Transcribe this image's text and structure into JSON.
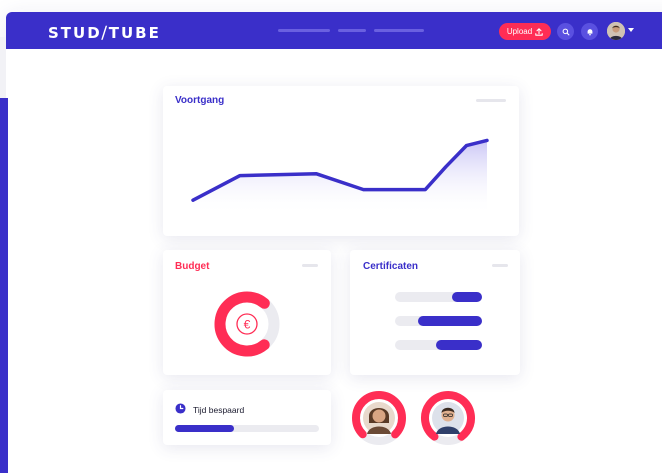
{
  "app": {
    "logo": "STUD⧸TUBE",
    "upload_label": "Upload",
    "colors": {
      "brand": "#3a2fc9",
      "accent": "#ff2d55"
    },
    "icons": {
      "upload": "upload-icon",
      "search": "search-icon",
      "bell": "bell-icon",
      "caret": "chevron-down-icon"
    }
  },
  "cards": {
    "progress": {
      "title": "Voortgang"
    },
    "budget": {
      "title": "Budget",
      "symbol": "€"
    },
    "certificates": {
      "title": "Certificaten"
    },
    "time_saved": {
      "label": "Tijd bespaard"
    }
  },
  "chart_data": {
    "type": "area",
    "title": "Voortgang",
    "x": [
      0,
      1,
      2,
      3,
      4,
      5,
      6,
      7
    ],
    "values": [
      10,
      38,
      40,
      22,
      22,
      48,
      72,
      78
    ],
    "ylim": [
      0,
      100
    ],
    "grid": false
  },
  "budget_ring": {
    "fraction": 0.72
  },
  "certificate_bars": [
    {
      "fraction": 0.34
    },
    {
      "fraction": 0.73
    },
    {
      "fraction": 0.53
    }
  ],
  "time_saved_progress": 0.41,
  "avatar_rings": [
    {
      "fraction": 0.75
    },
    {
      "fraction": 0.8
    }
  ]
}
